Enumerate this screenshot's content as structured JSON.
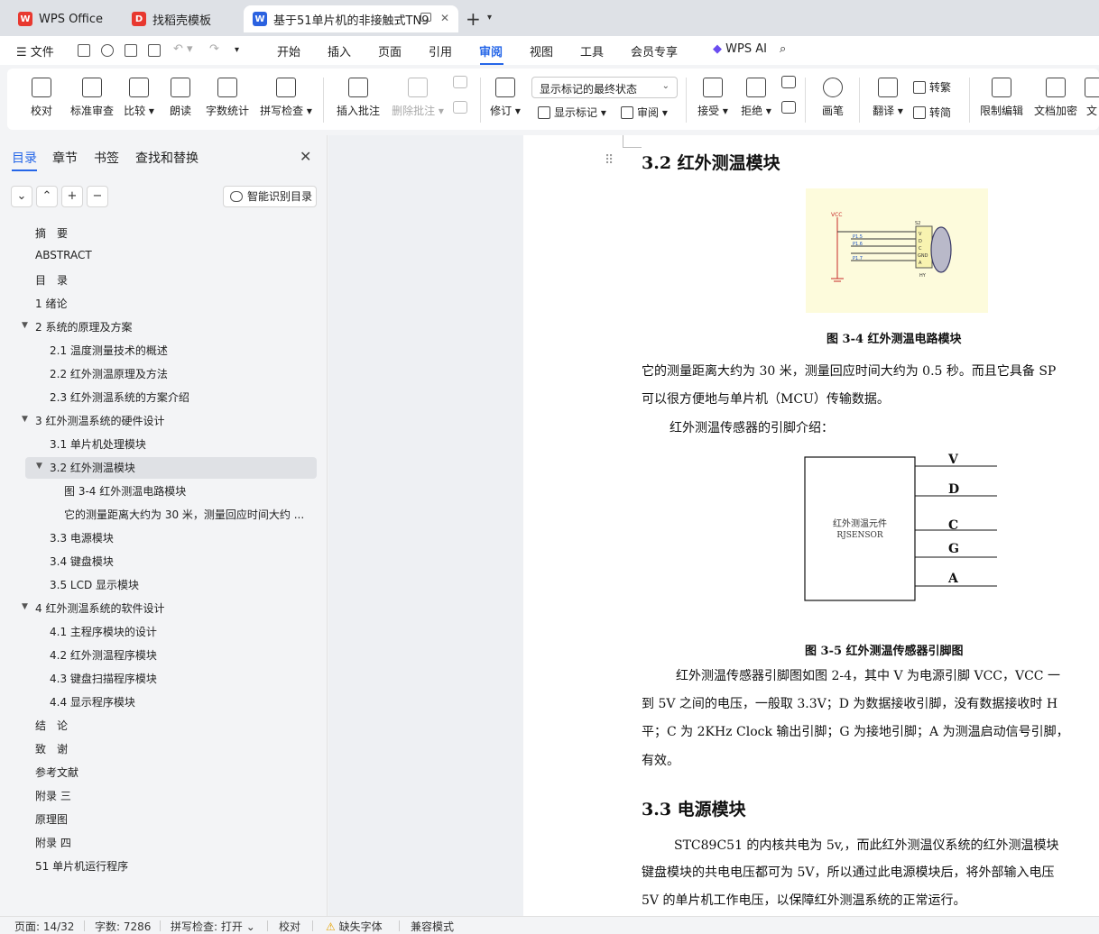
{
  "tabs": [
    {
      "label": "WPS Office",
      "icon": "wps-logo-icon"
    },
    {
      "label": "找稻壳模板",
      "icon": "docer-icon"
    },
    {
      "label": "基于51单片机的非接触式TN9",
      "icon": "wps-writer-icon"
    }
  ],
  "menu": {
    "file": "文件",
    "items": [
      "开始",
      "插入",
      "页面",
      "引用",
      "审阅",
      "视图",
      "工具",
      "会员专享"
    ],
    "active": "审阅",
    "ai": "WPS AI"
  },
  "ribbon": {
    "proof": "校对",
    "standard_review": "标准审查",
    "compare": "比较",
    "read_aloud": "朗读",
    "word_count": "字数统计",
    "spell_check": "拼写检查",
    "insert_comment": "插入批注",
    "delete_comment": "删除批注",
    "revise": "修订",
    "markup_state": "显示标记的最终状态",
    "show_markup": "显示标记",
    "review": "审阅",
    "accept": "接受",
    "reject": "拒绝",
    "pen": "画笔",
    "translate": "翻译",
    "to_traditional": "转繁",
    "to_simplified": "转简",
    "restrict_edit": "限制编辑",
    "encrypt": "文档加密",
    "more": "文"
  },
  "panel": {
    "tabs": [
      "目录",
      "章节",
      "书签",
      "查找和替换"
    ],
    "smart_toc": "智能识别目录",
    "toc": [
      {
        "label": "摘　要",
        "level": 0
      },
      {
        "label": "ABSTRACT",
        "level": 0
      },
      {
        "label": "目　录",
        "level": 0
      },
      {
        "label": "1 绪论",
        "level": 0
      },
      {
        "label": "2  系统的原理及方案",
        "level": 0,
        "expanded": true
      },
      {
        "label": "2.1 温度测量技术的概述",
        "level": 1
      },
      {
        "label": "2.2  红外测温原理及方法",
        "level": 1
      },
      {
        "label": "2.3  红外测温系统的方案介绍",
        "level": 1
      },
      {
        "label": "3  红外测温系统的硬件设计",
        "level": 0,
        "expanded": true
      },
      {
        "label": "3.1  单片机处理模块",
        "level": 1
      },
      {
        "label": "3.2  红外测温模块",
        "level": 1,
        "expanded": true,
        "selected": true
      },
      {
        "label": "图 3-4  红外测温电路模块",
        "level": 2
      },
      {
        "label": "它的测量距离大约为 30 米，测量回应时间大约 ...",
        "level": 2
      },
      {
        "label": "3.3  电源模块",
        "level": 1
      },
      {
        "label": "3.4  键盘模块",
        "level": 1
      },
      {
        "label": "3.5 LCD 显示模块",
        "level": 1
      },
      {
        "label": "4  红外测温系统的软件设计",
        "level": 0,
        "expanded": true
      },
      {
        "label": "4.1  主程序模块的设计",
        "level": 1
      },
      {
        "label": "4.2  红外测温程序模块",
        "level": 1
      },
      {
        "label": "4.3  键盘扫描程序模块",
        "level": 1
      },
      {
        "label": "4.4  显示程序模块",
        "level": 1
      },
      {
        "label": "结　论",
        "level": 0
      },
      {
        "label": "致　谢",
        "level": 0
      },
      {
        "label": "参考文献",
        "level": 0
      },
      {
        "label": "附录 三",
        "level": 0
      },
      {
        "label": "原理图",
        "level": 0
      },
      {
        "label": "附录 四",
        "level": 0
      },
      {
        "label": "51 单片机运行程序",
        "level": 0
      }
    ]
  },
  "doc": {
    "heading_32": "3.2  红外测温模块",
    "circuit_labels": {
      "vcc": "VCC",
      "s2": "S2",
      "p15": "P1.5",
      "p16": "P1.6",
      "p17": "P1.7",
      "v": "V",
      "d": "D",
      "c": "C",
      "gnd": "GND",
      "a": "A",
      "hy": "HY"
    },
    "fig34": "图 3-4  红外测温电路模块",
    "para1a": "它的测量距离大约为 30 米，测量回应时间大约为 0.5 秒。而且它具备 SP",
    "para1b": "可以很方便地与单片机（MCU）传输数据。",
    "para2": "红外测温传感器的引脚介绍：",
    "sensor_box_line1": "红外测温元件",
    "sensor_box_line2": "RJSENSOR",
    "pins": [
      "V",
      "D",
      "C",
      "G",
      "A"
    ],
    "fig35": "图 3-5  红外测温传感器引脚图",
    "para3a": "红外测温传感器引脚图如图 2-4，其中 V 为电源引脚 VCC，VCC 一",
    "para3b": "到 5V 之间的电压，一般取 3.3V；D 为数据接收引脚，没有数据接收时 H",
    "para3c": "平；C 为 2KHz Clock 输出引脚；G 为接地引脚；A 为测温启动信号引脚，",
    "para3d": "有效。",
    "heading_33": "3.3  电源模块",
    "para4a": "STC89C51 的内核共电为 5v,，而此红外测温仪系统的红外测温模块",
    "para4b": "键盘模块的共电电压都可为 5V，所以通过此电源模块后，将外部输入电压",
    "para4c": "5V 的单片机工作电压，以保障红外测温系统的正常运行。"
  },
  "status": {
    "page": "页面: 14/32",
    "words": "字数: 7286",
    "spell": "拼写检查: 打开",
    "proof": "校对",
    "missing_font": "缺失字体",
    "compat": "兼容模式"
  }
}
